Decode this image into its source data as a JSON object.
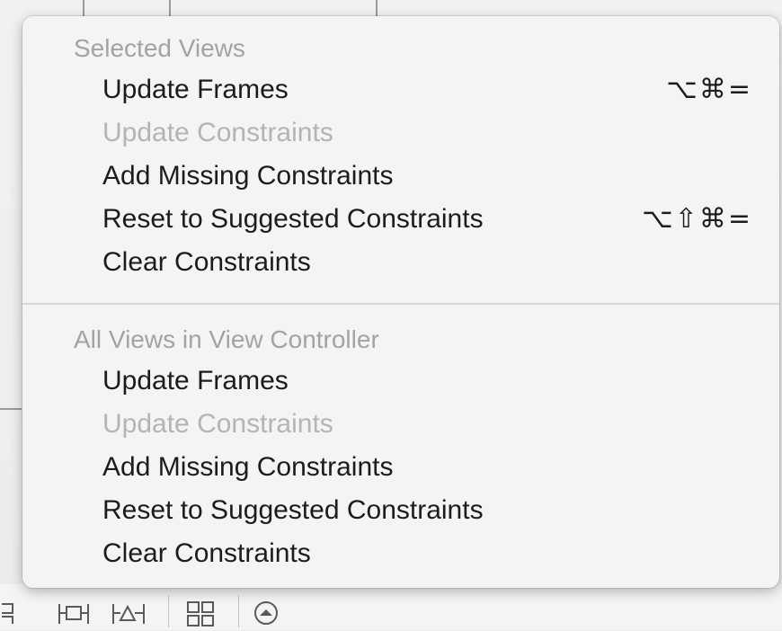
{
  "menu": {
    "sections": [
      {
        "header": "Selected Views",
        "items": [
          {
            "label": "Update Frames",
            "shortcut": "⌥⌘=",
            "enabled": true
          },
          {
            "label": "Update Constraints",
            "shortcut": "",
            "enabled": false
          },
          {
            "label": "Add Missing Constraints",
            "shortcut": "",
            "enabled": true
          },
          {
            "label": "Reset to Suggested Constraints",
            "shortcut": "⌥⇧⌘=",
            "enabled": true
          },
          {
            "label": "Clear Constraints",
            "shortcut": "",
            "enabled": true
          }
        ]
      },
      {
        "header": "All Views in View Controller",
        "items": [
          {
            "label": "Update Frames",
            "shortcut": "",
            "enabled": true
          },
          {
            "label": "Update Constraints",
            "shortcut": "",
            "enabled": false
          },
          {
            "label": "Add Missing Constraints",
            "shortcut": "",
            "enabled": true
          },
          {
            "label": "Reset to Suggested Constraints",
            "shortcut": "",
            "enabled": true
          },
          {
            "label": "Clear Constraints",
            "shortcut": "",
            "enabled": true
          }
        ]
      }
    ]
  },
  "toolbar": {
    "icons": [
      "align-icon",
      "pin-icon",
      "resolve-auto-layout-icon",
      "embed-in-stack-icon",
      "resizing-behavior-icon"
    ]
  },
  "colors": {
    "menu_background": "#f4f4f2",
    "enabled_text": "#1c1c1c",
    "disabled_text": "#b4b4b4",
    "header_text": "#a3a3a3"
  }
}
